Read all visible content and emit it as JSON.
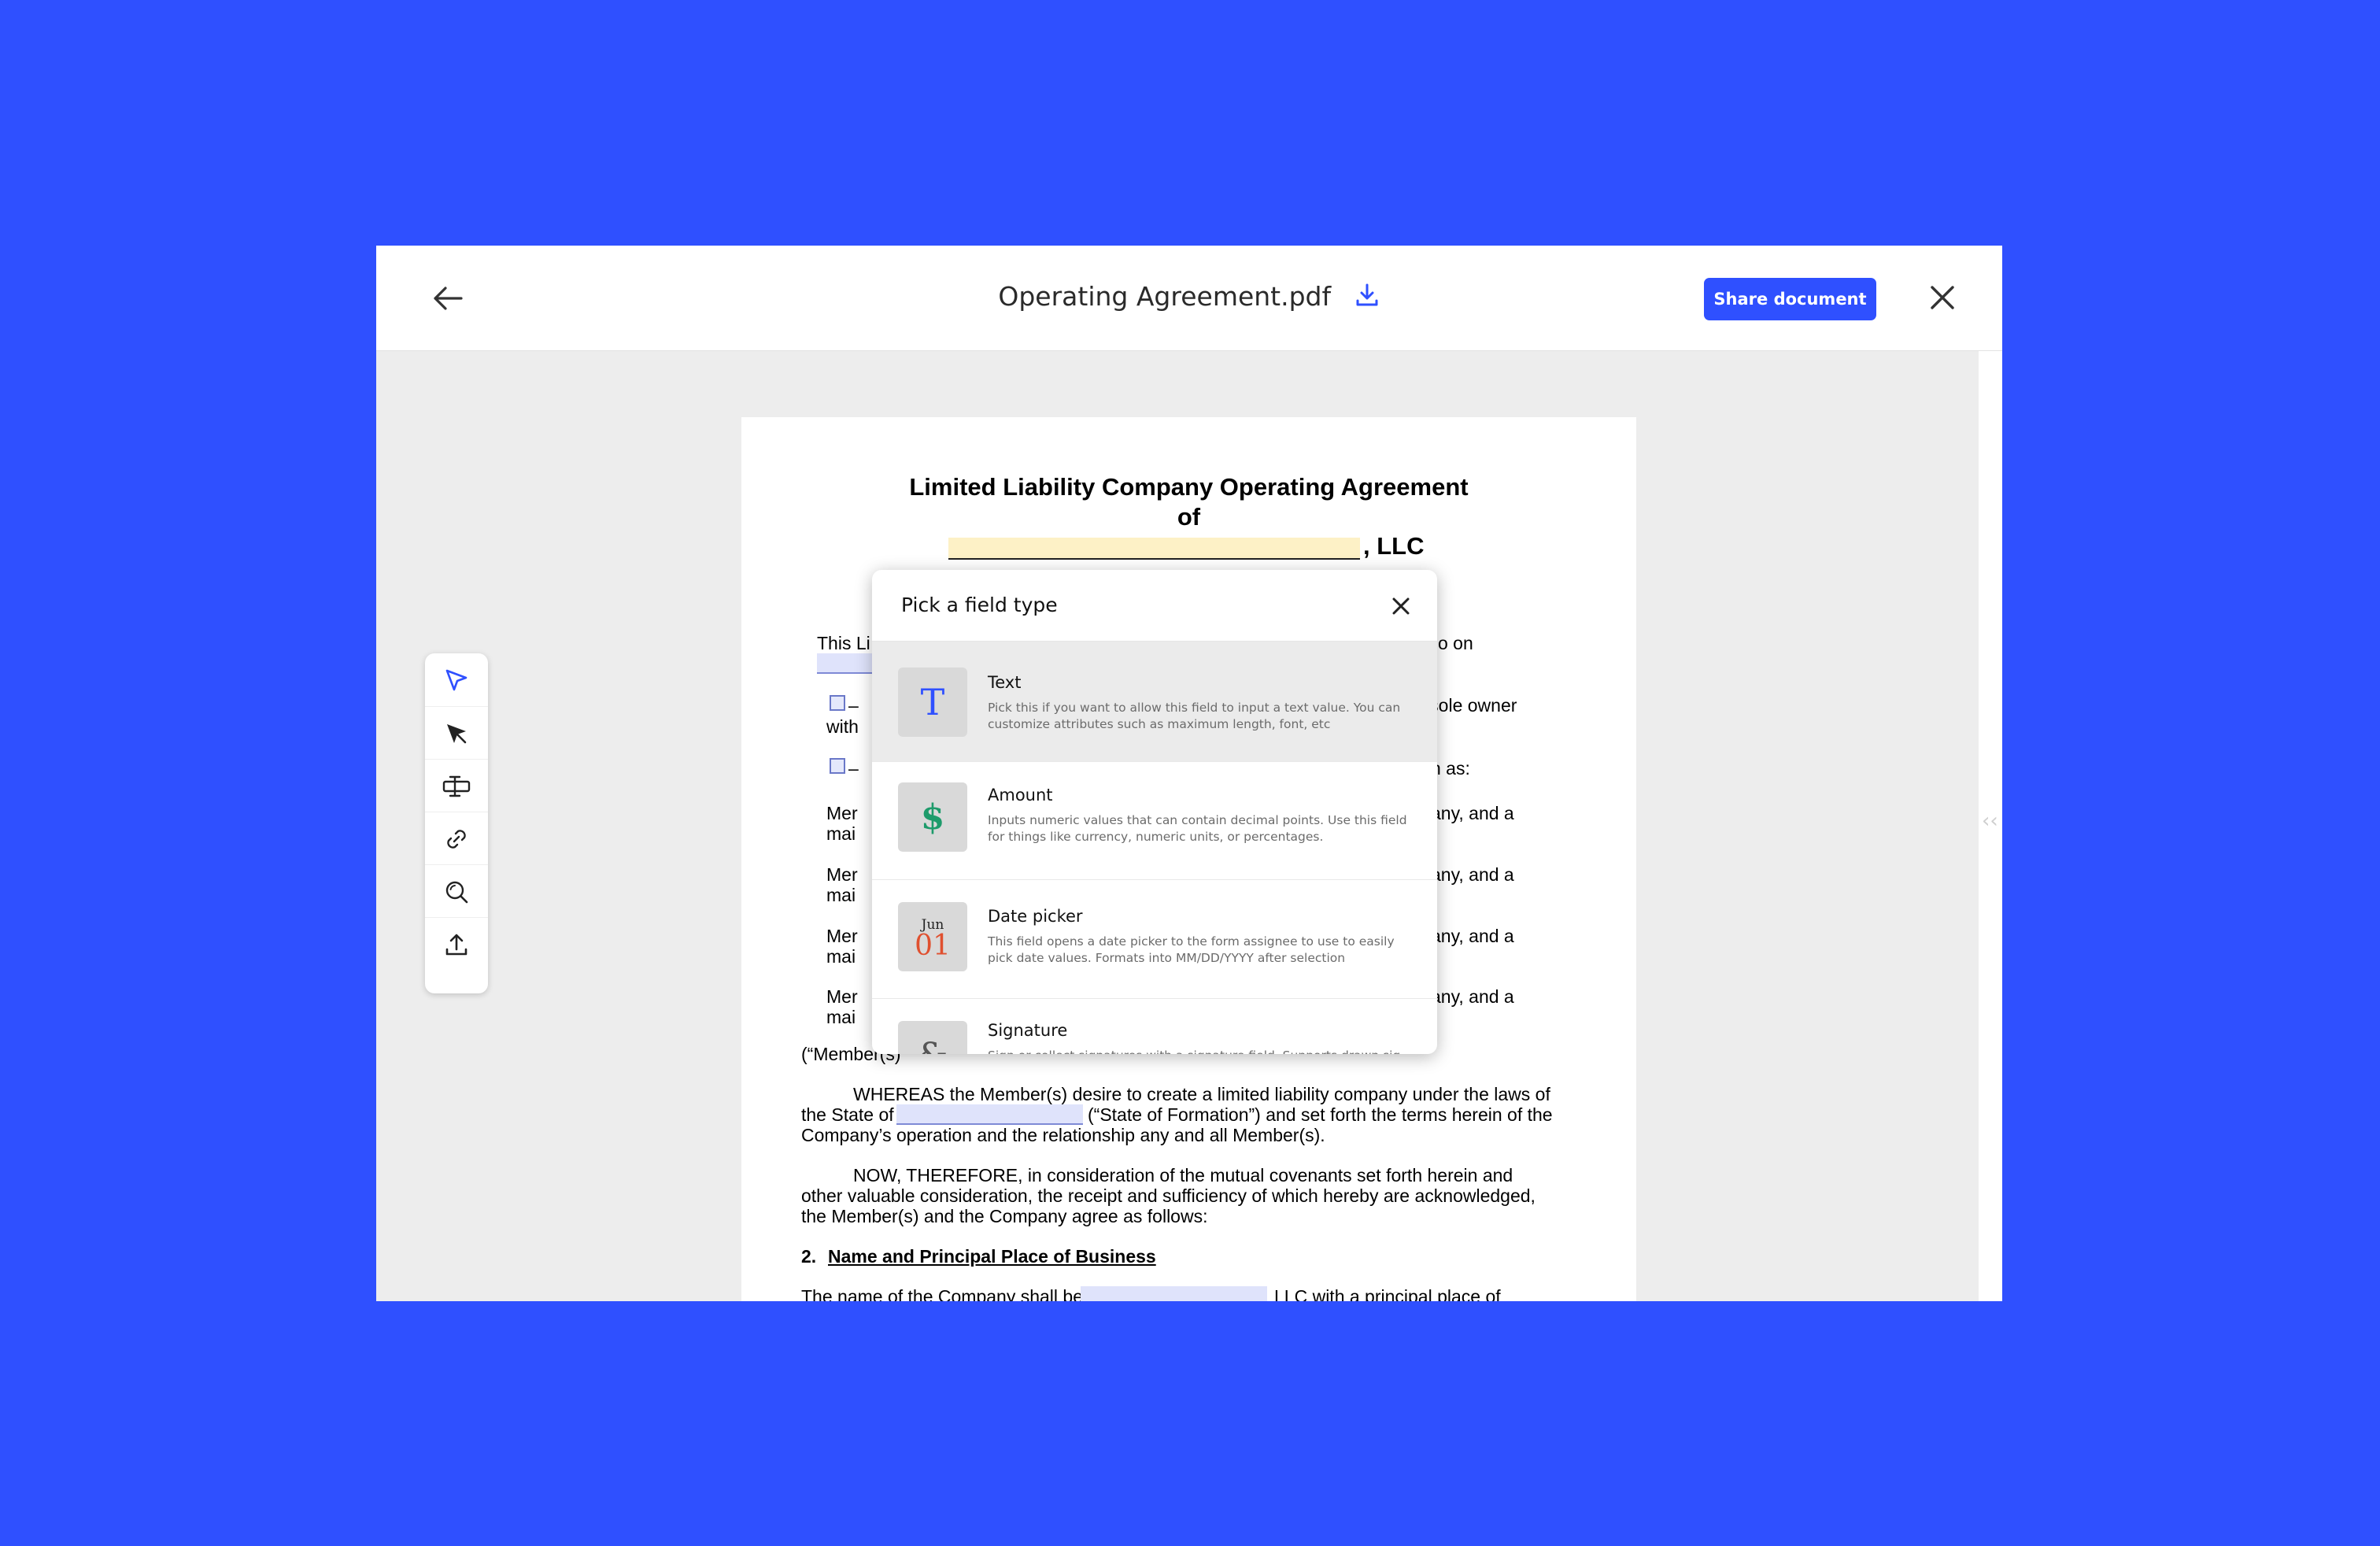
{
  "header": {
    "file_name": "Operating Agreement.pdf",
    "share_label": "Share document"
  },
  "colors": {
    "accent": "#2f50ff",
    "background": "#2f50ff"
  },
  "toolbar": {
    "tools": [
      "select-cursor-icon",
      "pointer-arrow-icon",
      "text-field-icon",
      "link-icon",
      "zoom-icon",
      "upload-icon"
    ]
  },
  "document": {
    "title_line1": "Limited Liability Company Operating Agreement",
    "title_line2": "of",
    "title_suffix": ", LLC",
    "intro_start": "This Li",
    "intro_end": "o on",
    "check1_start": "–",
    "check1_end": "e sole owner",
    "check1_line2": "with",
    "check2_start": "–",
    "check2_end": "n as:",
    "member_start": "Mer",
    "member_end": "any, and a",
    "member_line2": "mai",
    "members_label": "(“Member(s)”",
    "whereas_line1": "WHEREAS the Member(s) desire to create a limited liability company under the laws of",
    "whereas_line2_start": "the State of",
    "whereas_line2_end": "(“State of Formation”) and set forth the terms herein of the",
    "whereas_line3": "Company’s operation and the relationship any and all Member(s).",
    "now_line1": "NOW, THEREFORE, in consideration of the mutual covenants set forth herein and",
    "now_line2": "other valuable consideration, the receipt and sufficiency of which hereby are acknowledged,",
    "now_line3": "the Member(s) and the Company agree as follows:",
    "section_number": "2.",
    "section_title": "Name and Principal Place of Business",
    "last_line_start": "The name of the Company shall be",
    "last_line_end": "LLC with a principal place of"
  },
  "field_picker": {
    "title": "Pick a field type",
    "options": [
      {
        "name": "Text",
        "icon_glyph": "T",
        "icon_color": "#2f50ff",
        "description": "Pick this if you want to allow this field to input a text value. You can customize attributes such as maximum length, font, etc"
      },
      {
        "name": "Amount",
        "icon_glyph": "$",
        "icon_color": "#1e9b6b",
        "description": "Inputs numeric values that can contain decimal points. Use this field for things like currency, numeric units, or percentages."
      },
      {
        "name": "Date picker",
        "icon_month": "Jun",
        "icon_day": "01",
        "icon_color": "#e0502f",
        "description": "This field opens a date picker to the form assignee to use to easily pick date values. Formats into MM/DD/YYYY after selection"
      },
      {
        "name": "Signature",
        "icon_glyph": "&",
        "icon_color": "#555555",
        "description": "Sign or collect signatures with a signature field. Supports drawn sig-"
      }
    ]
  }
}
